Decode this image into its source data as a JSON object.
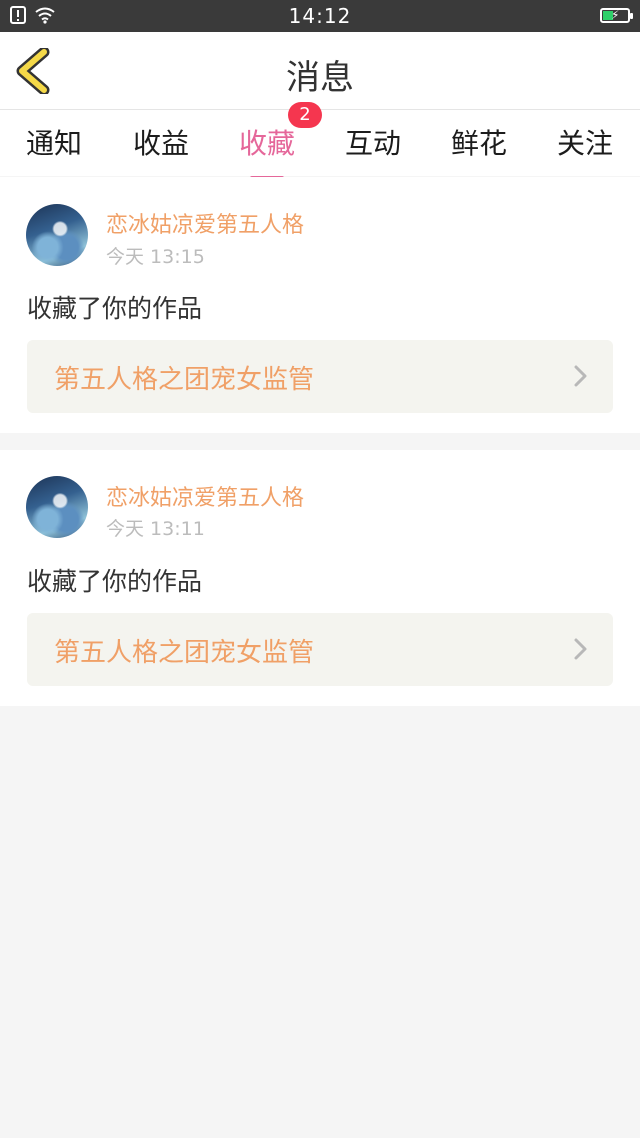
{
  "status_bar": {
    "time": "14:12"
  },
  "header": {
    "title": "消息"
  },
  "tabs": [
    {
      "label": "通知"
    },
    {
      "label": "收益"
    },
    {
      "label": "收藏",
      "active": true,
      "badge": "2"
    },
    {
      "label": "互动"
    },
    {
      "label": "鲜花"
    },
    {
      "label": "关注"
    }
  ],
  "messages": [
    {
      "user": "恋冰姑凉爱第五人格",
      "time": "今天 13:15",
      "action": "收藏了你的作品",
      "work_title": "第五人格之团宠女监管"
    },
    {
      "user": "恋冰姑凉爱第五人格",
      "time": "今天 13:11",
      "action": "收藏了你的作品",
      "work_title": "第五人格之团宠女监管"
    }
  ],
  "colors": {
    "accent": "#e5679a",
    "username": "#f0a067",
    "badge": "#f5364f",
    "back_arrow": "#f5d948"
  },
  "icons": [
    "sim-alert-icon",
    "wifi-icon",
    "battery-icon",
    "back-arrow-icon",
    "chevron-right-icon"
  ]
}
